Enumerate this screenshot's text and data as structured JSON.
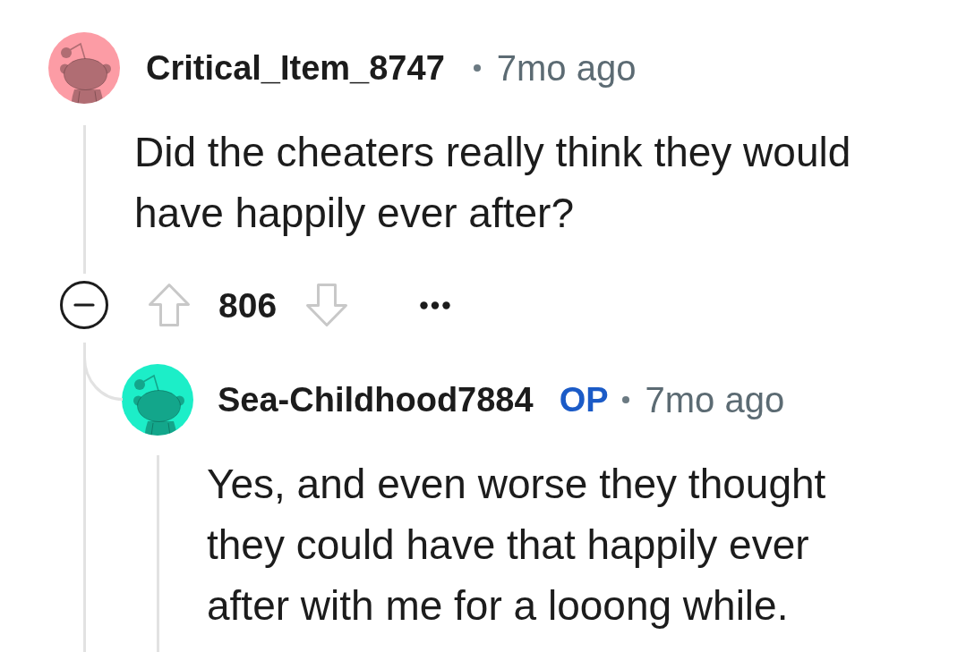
{
  "comments": [
    {
      "author": "Critical_Item_8747",
      "color": "#fc9ca5",
      "time": "7mo ago",
      "body": "Did the cheaters really think they would have happily ever after?",
      "expanded": true,
      "votes": "806",
      "replies": [
        {
          "author": "Sea-Childhood7884",
          "color": "#1ceec8",
          "badge": "OP",
          "time": "7mo ago",
          "body": "Yes, and even worse they thought they could have that happily ever after with me for a looong while."
        }
      ]
    }
  ]
}
